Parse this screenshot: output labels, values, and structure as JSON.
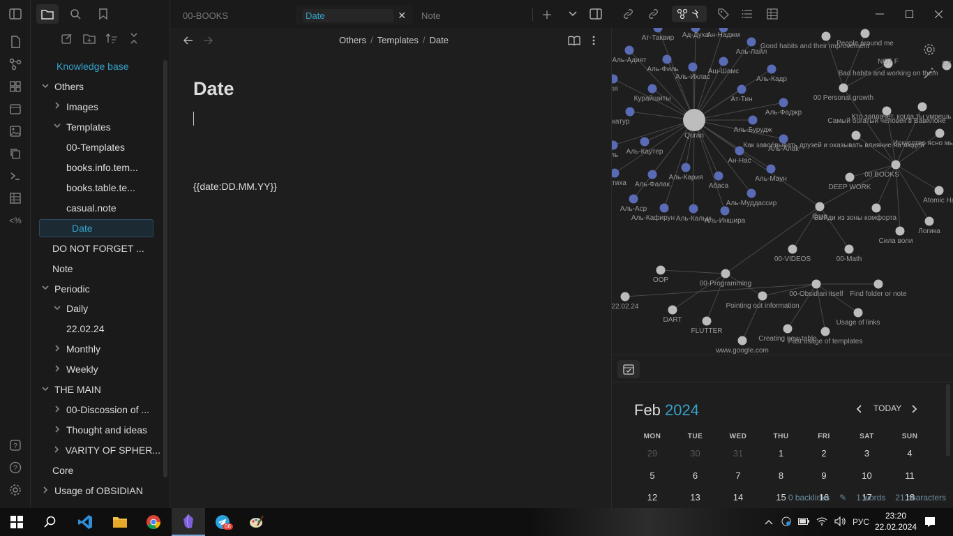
{
  "ribbon": {
    "icons": [
      "sidebar-toggle-icon",
      "file-icon",
      "graph-icon",
      "grid-icon",
      "calendar-icon",
      "image-icon",
      "copy-icon",
      "terminal-icon",
      "table-icon",
      "template-icon",
      "help-icon",
      "question-icon",
      "settings-icon"
    ]
  },
  "sidebar": {
    "top_icons": [
      "folder-icon",
      "search-icon",
      "bookmark-icon"
    ],
    "tools": [
      "new-note-icon",
      "new-folder-icon",
      "sort-icon",
      "collapse-icon"
    ],
    "vault_name": "Knowledge base",
    "items": [
      {
        "label": "Others",
        "depth": 0,
        "chev": "v"
      },
      {
        "label": "Images",
        "depth": 1,
        "chev": ">"
      },
      {
        "label": "Templates",
        "depth": 1,
        "chev": "v"
      },
      {
        "label": "00-Templates",
        "depth": 2,
        "chev": ""
      },
      {
        "label": "books.info.tem...",
        "depth": 2,
        "chev": ""
      },
      {
        "label": "books.table.te...",
        "depth": 2,
        "chev": ""
      },
      {
        "label": "casual.note",
        "depth": 2,
        "chev": ""
      },
      {
        "label": "Date",
        "depth": 2,
        "chev": "",
        "selected": true
      },
      {
        "label": "DO NOT FORGET ...",
        "depth": 1,
        "chev": ""
      },
      {
        "label": "Note",
        "depth": 1,
        "chev": ""
      },
      {
        "label": "Periodic",
        "depth": 0,
        "chev": "v"
      },
      {
        "label": "Daily",
        "depth": 1,
        "chev": "v"
      },
      {
        "label": "22.02.24",
        "depth": 2,
        "chev": ""
      },
      {
        "label": "Monthly",
        "depth": 1,
        "chev": ">"
      },
      {
        "label": "Weekly",
        "depth": 1,
        "chev": ">"
      },
      {
        "label": "THE MAIN",
        "depth": 0,
        "chev": "v"
      },
      {
        "label": "00-Discossion of ...",
        "depth": 1,
        "chev": ">"
      },
      {
        "label": "Thought and ideas",
        "depth": 1,
        "chev": ">"
      },
      {
        "label": "VARITY OF SPHER...",
        "depth": 1,
        "chev": ">"
      },
      {
        "label": "Core",
        "depth": 1,
        "chev": ""
      },
      {
        "label": "Usage of OBSIDIAN",
        "depth": 0,
        "chev": ">"
      }
    ]
  },
  "editor": {
    "tabs": [
      {
        "label": "00-BOOKS",
        "active": false
      },
      {
        "label": "Date",
        "active": true
      },
      {
        "label": "Note",
        "active": false
      }
    ],
    "breadcrumb": [
      "Others",
      "Templates",
      "Date"
    ],
    "title": "Date",
    "body": "{{date:DD.MM.YY}}"
  },
  "graph": {
    "nodes": [
      {
        "label": "Quran",
        "hub": true
      },
      {
        "label": "Ат-Такатур"
      },
      {
        "label": "Аль-Адият"
      },
      {
        "label": "Аль-Филь"
      },
      {
        "label": "Аль-Ихлас"
      },
      {
        "label": "Аш-Шамс"
      },
      {
        "label": "Аль-Лайл"
      },
      {
        "label": "Аль-Кадр"
      },
      {
        "label": "Ат-Тин"
      },
      {
        "label": "Аль-Фаджр"
      },
      {
        "label": "Аль-Бурудж"
      },
      {
        "label": "Аль-Алак"
      },
      {
        "label": "Ан-Нас"
      },
      {
        "label": "Аль-Маун"
      },
      {
        "label": "Аль-Муддассир"
      },
      {
        "label": "Абаса"
      },
      {
        "label": "Аль-Кария"
      },
      {
        "label": "Аль-Фалак"
      },
      {
        "label": "Аль-Каутер"
      },
      {
        "label": "Курайшиты"
      },
      {
        "label": "Аль-Аср"
      },
      {
        "label": "Аль-Кафирун"
      },
      {
        "label": "Аль-Кальм"
      },
      {
        "label": "Аль-Иншира"
      },
      {
        "label": "Ат-Таквир"
      },
      {
        "label": "Ад-Духа"
      },
      {
        "label": "Ан-Наджм"
      },
      {
        "label": "Фатиха"
      },
      {
        "label": "-Аля"
      },
      {
        "label": "ммиль"
      },
      {
        "label": "Good habits and their improvement"
      },
      {
        "label": "People around me"
      },
      {
        "label": "Bad habits and working on them"
      },
      {
        "label": "00 Personal growth"
      },
      {
        "label": "Самый богатый человек в Вавилоне"
      },
      {
        "label": "Кто заплачет, когда ты умрешь"
      },
      {
        "label": "Искусство ясно мыслить"
      },
      {
        "label": "Как завоёвывать друзей и оказывать влияние на людей"
      },
      {
        "label": "00 BOOKS"
      },
      {
        "label": "DEEP WORK"
      },
      {
        "label": "Atomic Habits"
      },
      {
        "label": "Core"
      },
      {
        "label": "Выйди из зоны комфорта"
      },
      {
        "label": "Логика"
      },
      {
        "label": "Сила воли"
      },
      {
        "label": "00-VIDEOS"
      },
      {
        "label": "00-Math"
      },
      {
        "label": "OOP"
      },
      {
        "label": "00-Programming"
      },
      {
        "label": "22.02.24"
      },
      {
        "label": "DART"
      },
      {
        "label": "FLUTTER"
      },
      {
        "label": "Pointing out information"
      },
      {
        "label": "00-Obsidian itself"
      },
      {
        "label": "Find folder or note"
      },
      {
        "label": "Usage of links"
      },
      {
        "label": "Creating new table"
      },
      {
        "label": "Fast usage of templates"
      },
      {
        "label": "www.google.com"
      },
      {
        "label": "NOT F"
      },
      {
        "label": "EX"
      }
    ]
  },
  "calendar": {
    "month": "Feb",
    "year": "2024",
    "today_label": "TODAY",
    "weekdays": [
      "MON",
      "TUE",
      "WED",
      "THU",
      "FRI",
      "SAT",
      "SUN"
    ],
    "rows": [
      [
        {
          "d": "29",
          "dim": true
        },
        {
          "d": "30",
          "dim": true
        },
        {
          "d": "31",
          "dim": true
        },
        {
          "d": "1"
        },
        {
          "d": "2"
        },
        {
          "d": "3"
        },
        {
          "d": "4"
        }
      ],
      [
        {
          "d": "5"
        },
        {
          "d": "6"
        },
        {
          "d": "7"
        },
        {
          "d": "8"
        },
        {
          "d": "9"
        },
        {
          "d": "10"
        },
        {
          "d": "11"
        }
      ],
      [
        {
          "d": "12"
        },
        {
          "d": "13"
        },
        {
          "d": "14"
        },
        {
          "d": "15"
        },
        {
          "d": "16"
        },
        {
          "d": "17"
        },
        {
          "d": "18"
        }
      ]
    ]
  },
  "statusbar": {
    "backlinks": "0 backlinks",
    "words": "1 words",
    "characters": "21 characters"
  },
  "taskbar": {
    "apps": [
      "windows-start-icon",
      "search-icon",
      "vscode-icon",
      "file-explorer-icon",
      "chrome-icon",
      "obsidian-icon",
      "telegram-icon",
      "paint-icon"
    ],
    "telegram_badge": "06",
    "language": "РУС",
    "time": "23:20",
    "date": "22.02.2024"
  }
}
